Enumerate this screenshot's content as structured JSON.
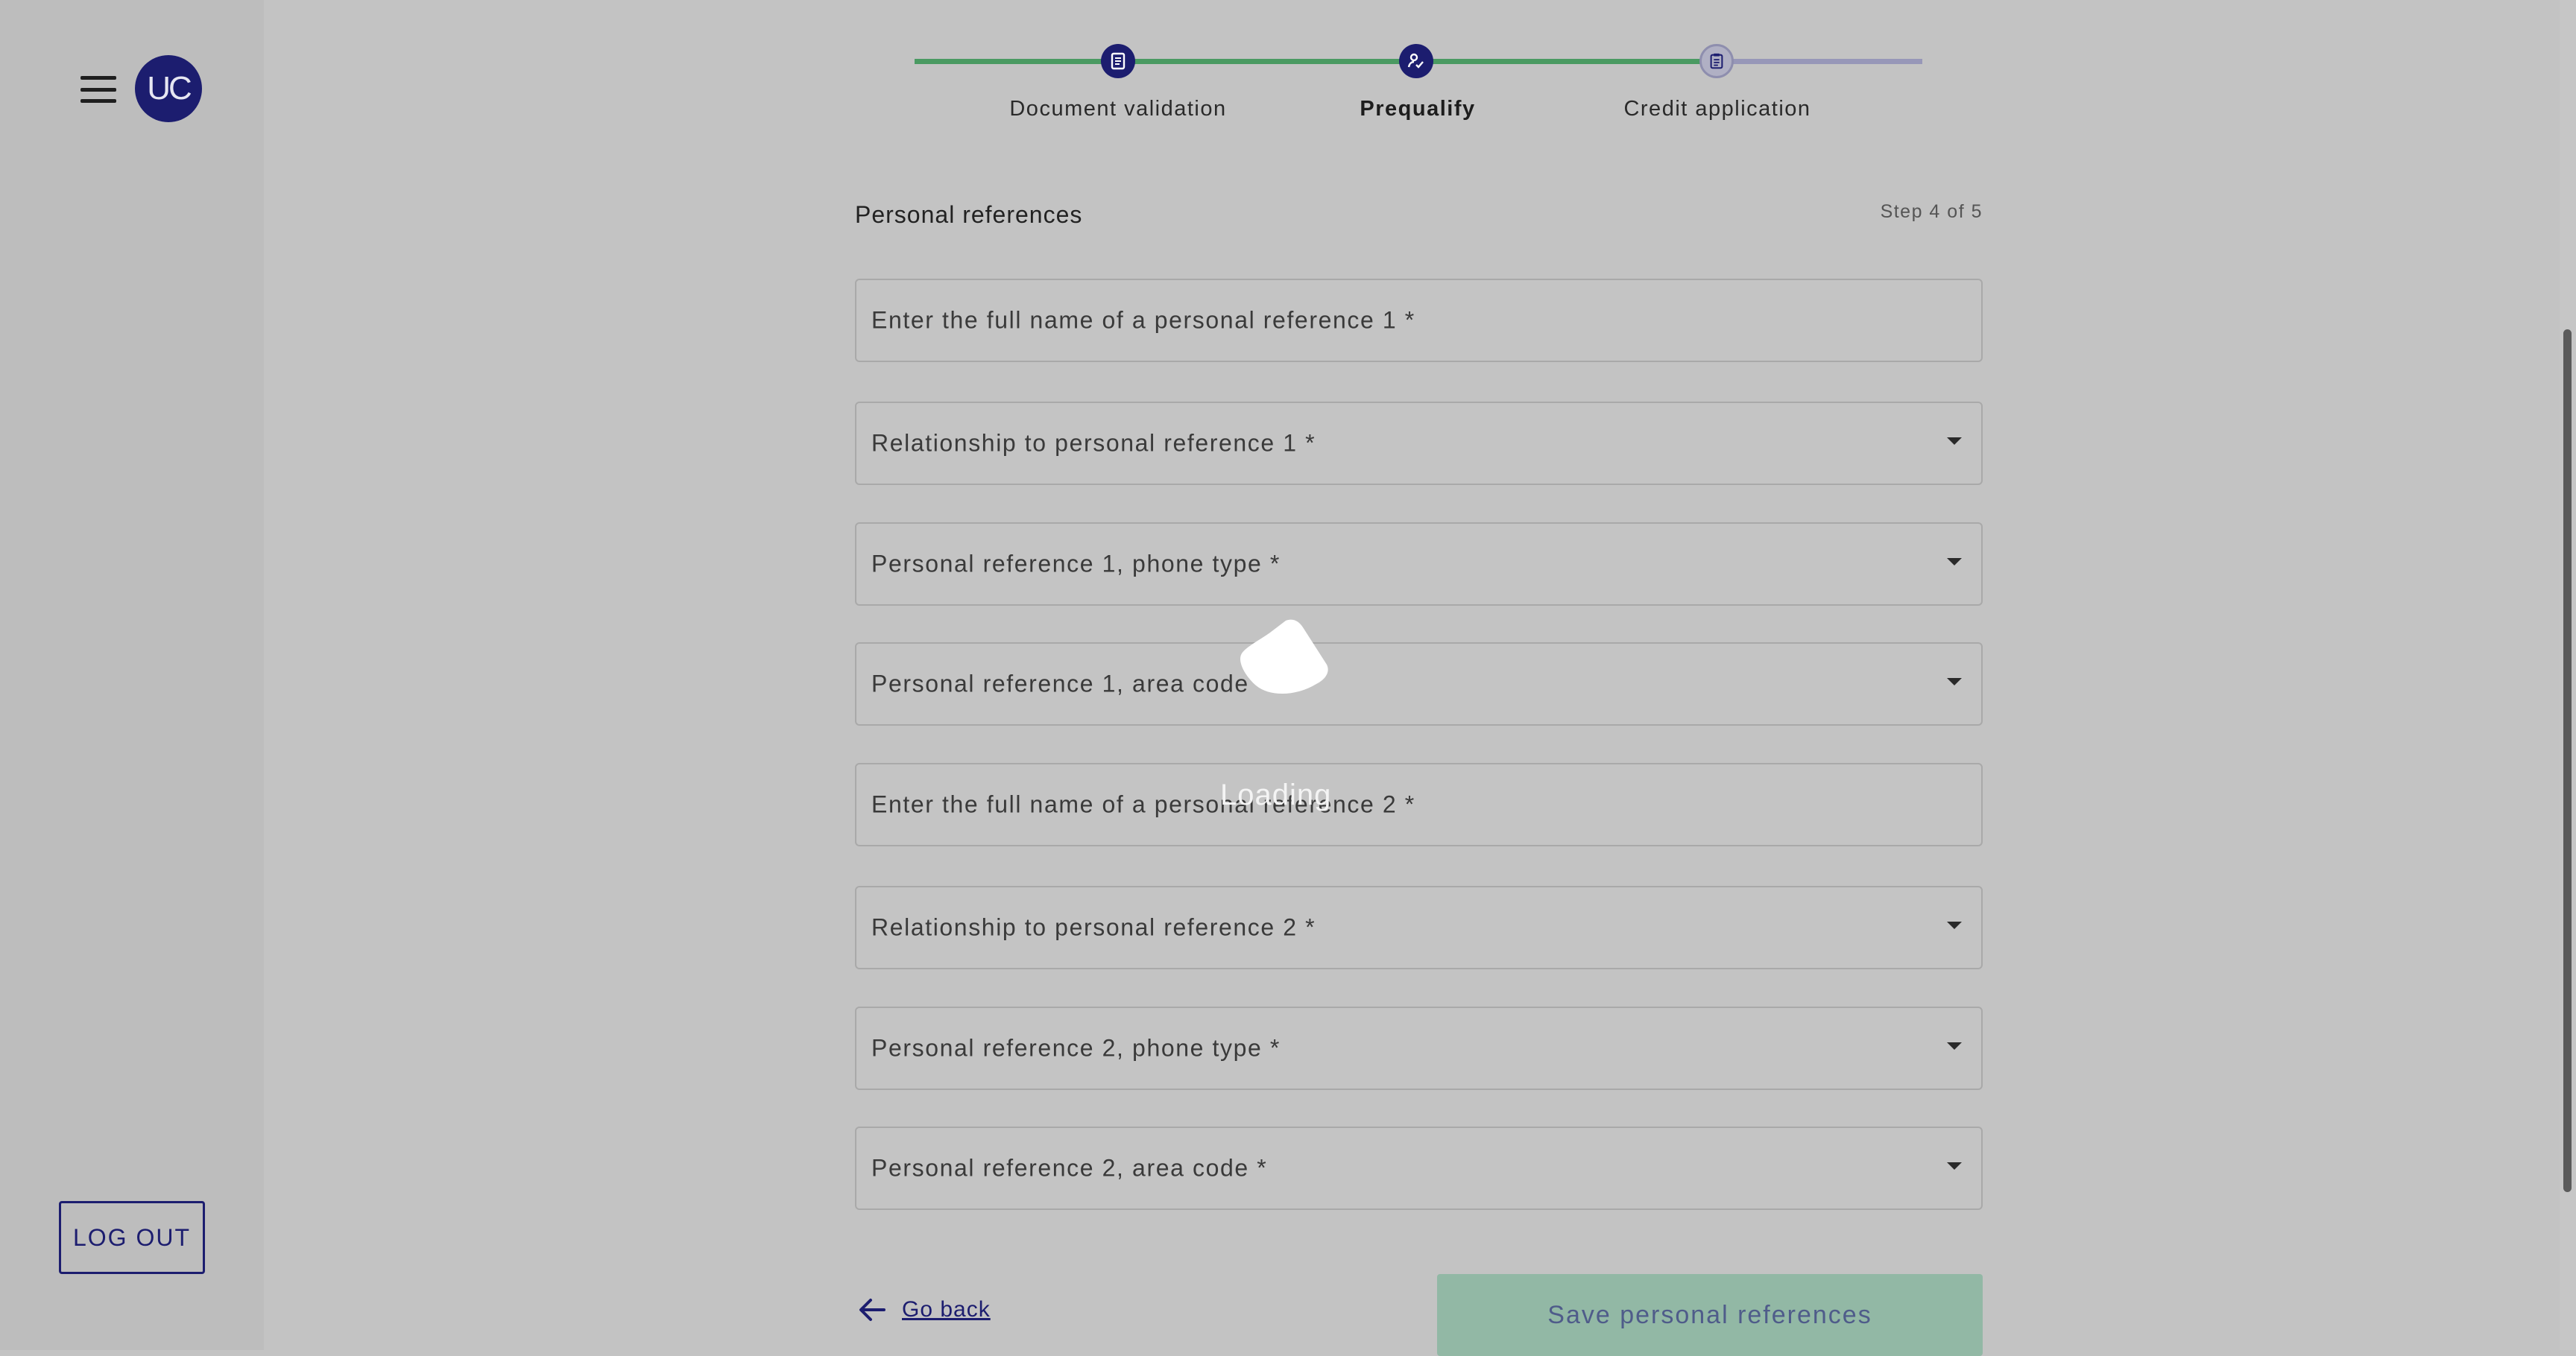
{
  "sidebar": {
    "avatar_initials": "UC",
    "logout_label": "LOG OUT"
  },
  "stepper": {
    "steps": [
      {
        "label": "Document validation",
        "state": "done"
      },
      {
        "label": "Prequalify",
        "state": "done"
      },
      {
        "label": "Credit application",
        "state": "current"
      }
    ]
  },
  "form": {
    "section_title": "Personal references",
    "step_count": "Step 4 of 5",
    "fields": [
      {
        "placeholder": "Enter the full name of a personal reference 1 *",
        "type": "text"
      },
      {
        "placeholder": "Relationship to personal reference 1 *",
        "type": "select"
      },
      {
        "placeholder": "Personal reference 1, phone type *",
        "type": "select"
      },
      {
        "placeholder": "Personal reference 1, area code *",
        "type": "select"
      },
      {
        "placeholder": "Enter the full name of a personal reference 2 *",
        "type": "text"
      },
      {
        "placeholder": "Relationship to personal reference 2 *",
        "type": "select"
      },
      {
        "placeholder": "Personal reference 2, phone type *",
        "type": "select"
      },
      {
        "placeholder": "Personal reference 2, area code *",
        "type": "select"
      }
    ],
    "go_back_label": "Go back",
    "save_label": "Save personal references"
  },
  "overlay": {
    "loading_text": "Loading"
  },
  "colors": {
    "brand": "#1c1d6f",
    "progress_complete": "#4a9a62",
    "progress_pending": "#9797b8"
  }
}
